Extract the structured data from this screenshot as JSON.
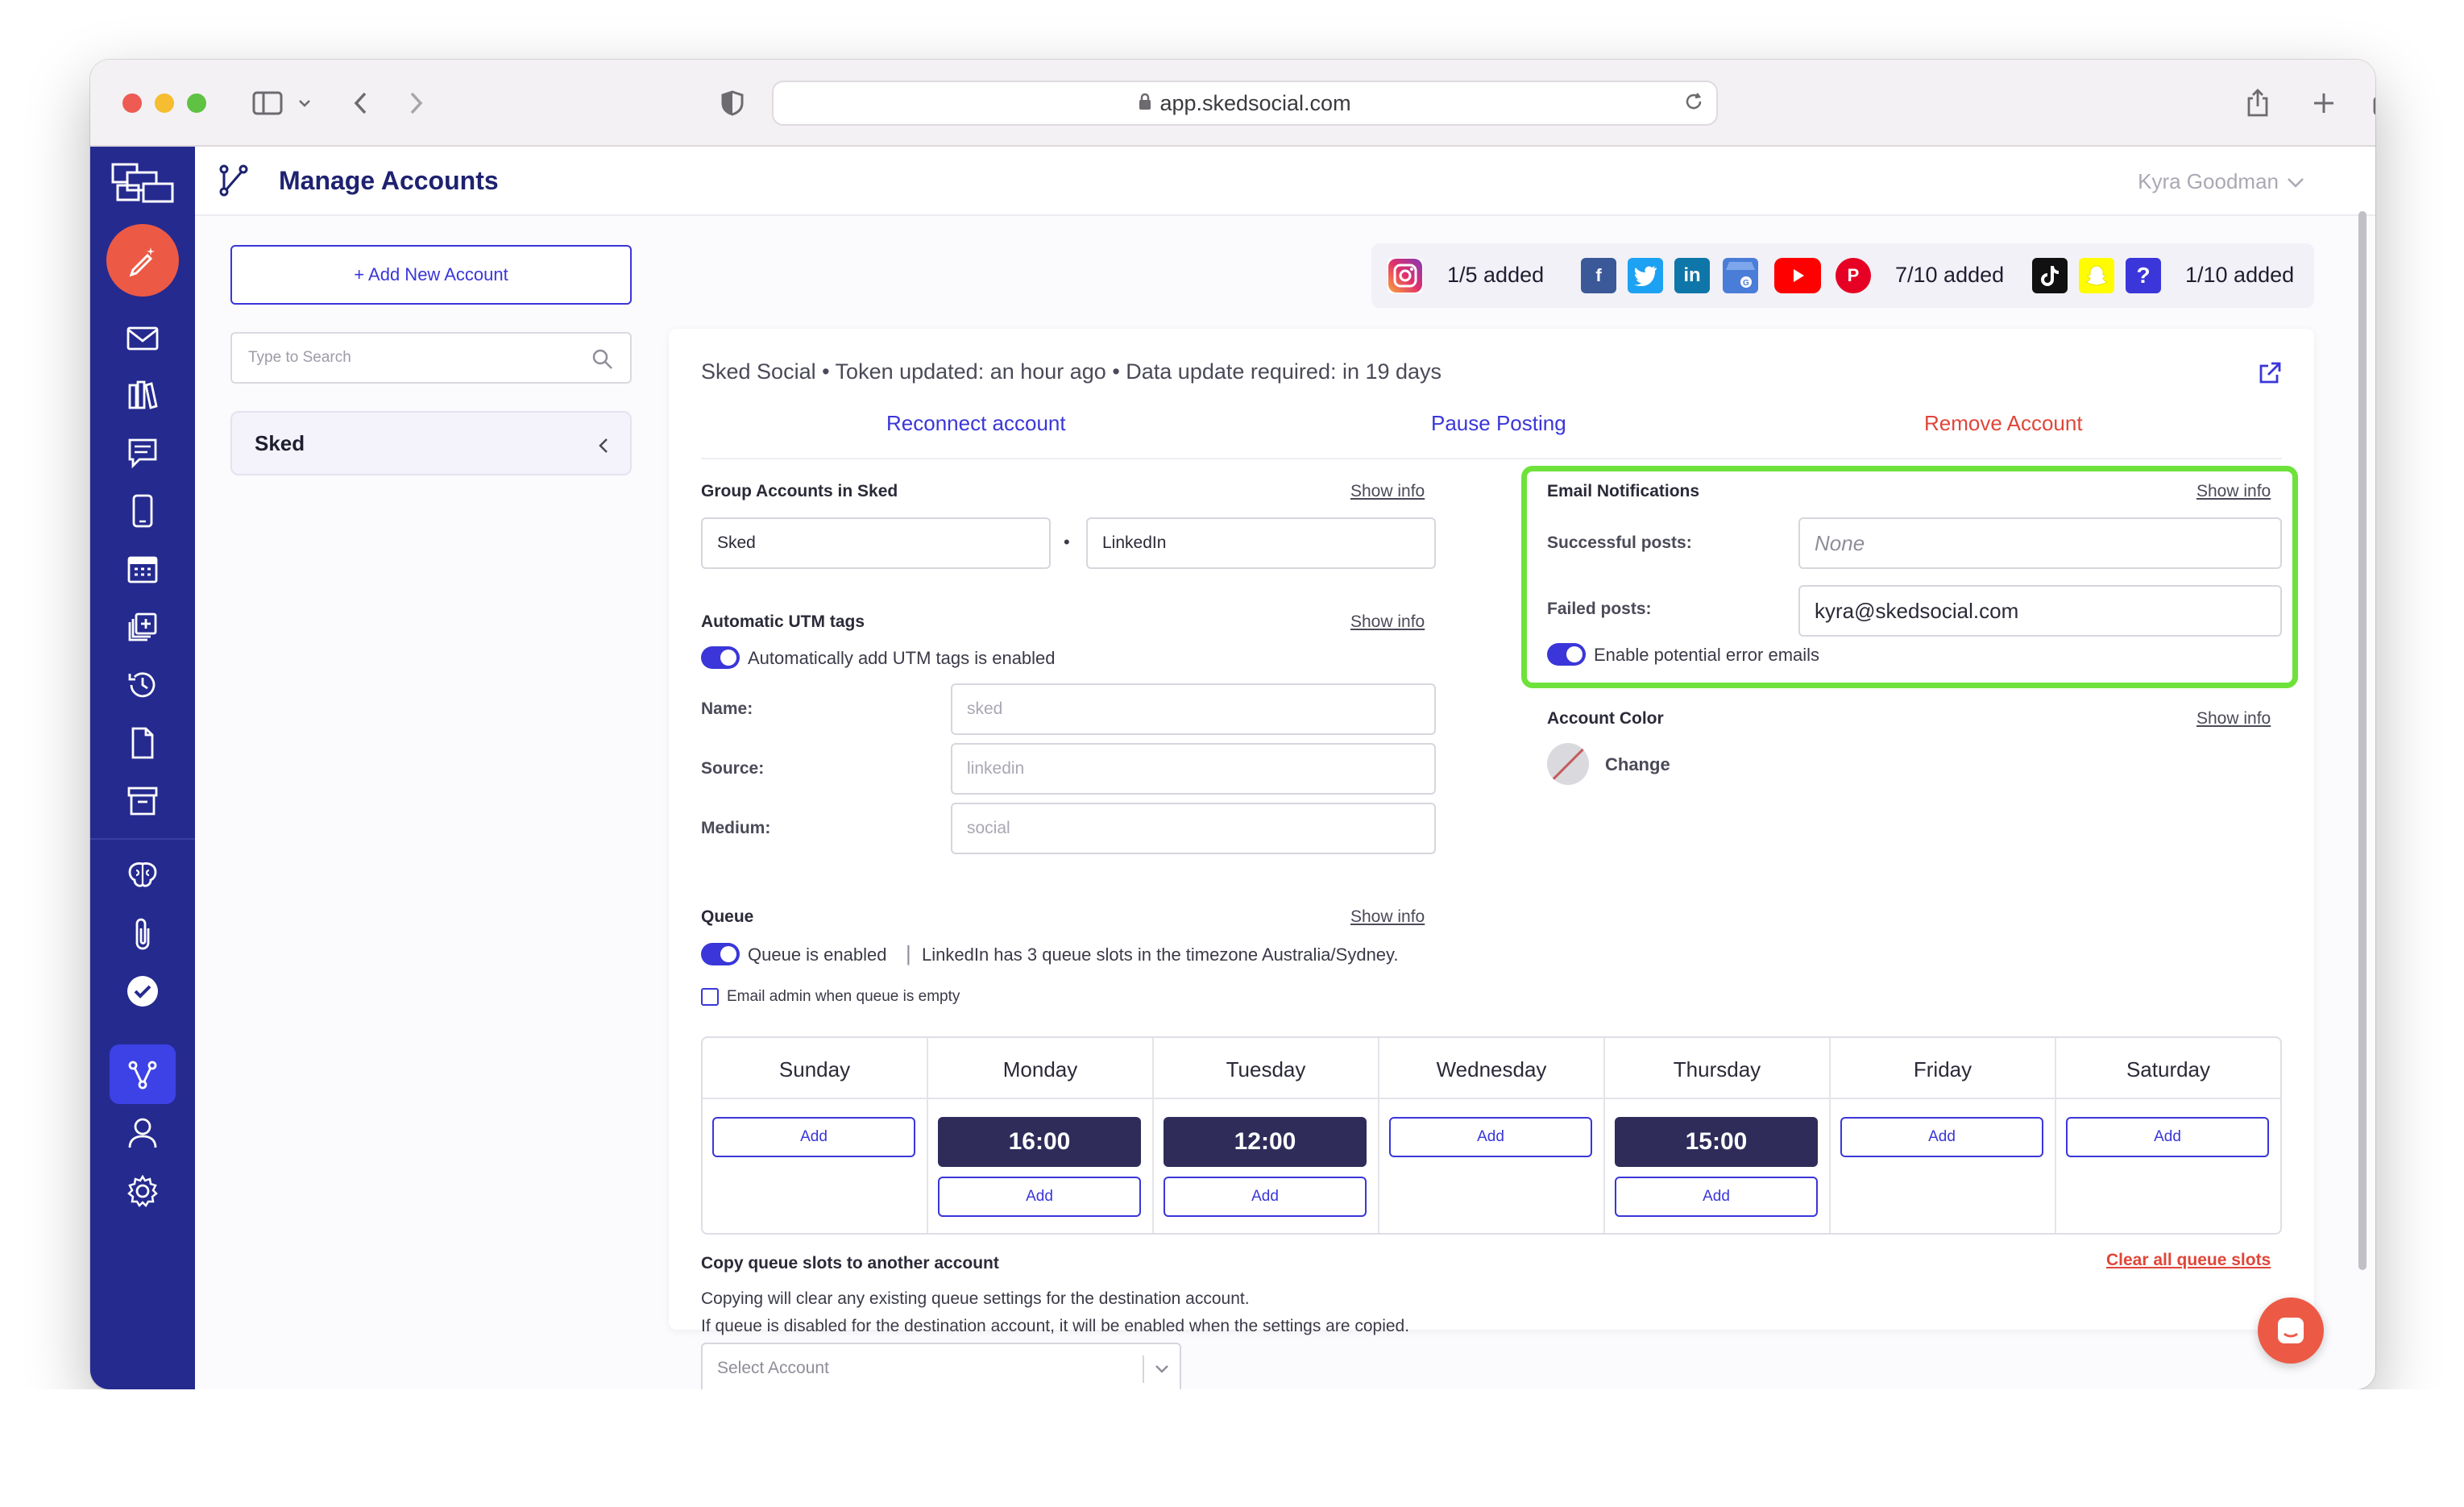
{
  "browser": {
    "url": "app.skedsocial.com"
  },
  "header": {
    "title": "Manage Accounts",
    "user": "Kyra Goodman"
  },
  "left_panel": {
    "add_button": "+ Add New Account",
    "search_placeholder": "Type to Search",
    "group_name": "Sked"
  },
  "platform_counts": {
    "instagram": "1/5 added",
    "social": "7/10 added",
    "other": "1/10 added"
  },
  "account": {
    "meta": "Sked Social  •  Token updated: an hour ago  •  Data update required: in 19 days",
    "reconnect": "Reconnect account",
    "pause": "Pause Posting",
    "remove": "Remove Account"
  },
  "group_section": {
    "title": "Group Accounts in Sked",
    "show_info": "Show info",
    "group_value": "Sked",
    "account_value": "LinkedIn",
    "dot": "•"
  },
  "utm": {
    "title": "Automatic UTM tags",
    "show_info": "Show info",
    "toggle_label": "Automatically add UTM tags is enabled",
    "name_label": "Name:",
    "name_placeholder": "sked",
    "source_label": "Source:",
    "source_placeholder": "linkedin",
    "medium_label": "Medium:",
    "medium_placeholder": "social"
  },
  "email": {
    "title": "Email Notifications",
    "show_info": "Show info",
    "successful_label": "Successful posts:",
    "successful_placeholder": "None",
    "failed_label": "Failed posts:",
    "failed_value": "kyra@skedsocial.com",
    "toggle_label": "Enable potential error emails"
  },
  "account_color": {
    "title": "Account Color",
    "show_info": "Show info",
    "change": "Change"
  },
  "queue": {
    "title": "Queue",
    "show_info": "Show info",
    "toggle_label": "Queue is enabled",
    "info": "LinkedIn has 3 queue slots in the timezone Australia/Sydney.",
    "email_admin": "Email admin when queue is empty",
    "days": [
      "Sunday",
      "Monday",
      "Tuesday",
      "Wednesday",
      "Thursday",
      "Friday",
      "Saturday"
    ],
    "add_label": "Add",
    "slots": {
      "monday": "16:00",
      "tuesday": "12:00",
      "thursday": "15:00"
    }
  },
  "copy": {
    "title": "Copy queue slots to another account",
    "line1": "Copying will clear any existing queue settings for the destination account.",
    "line2": "If queue is disabled for the destination account, it will be enabled when the settings are copied.",
    "select_placeholder": "Select Account",
    "clear_all": "Clear all queue slots"
  },
  "colors": {
    "sidebar": "#252a8f",
    "accent": "#3a36d9",
    "danger": "#e0463a",
    "highlight": "#6ee23a"
  }
}
